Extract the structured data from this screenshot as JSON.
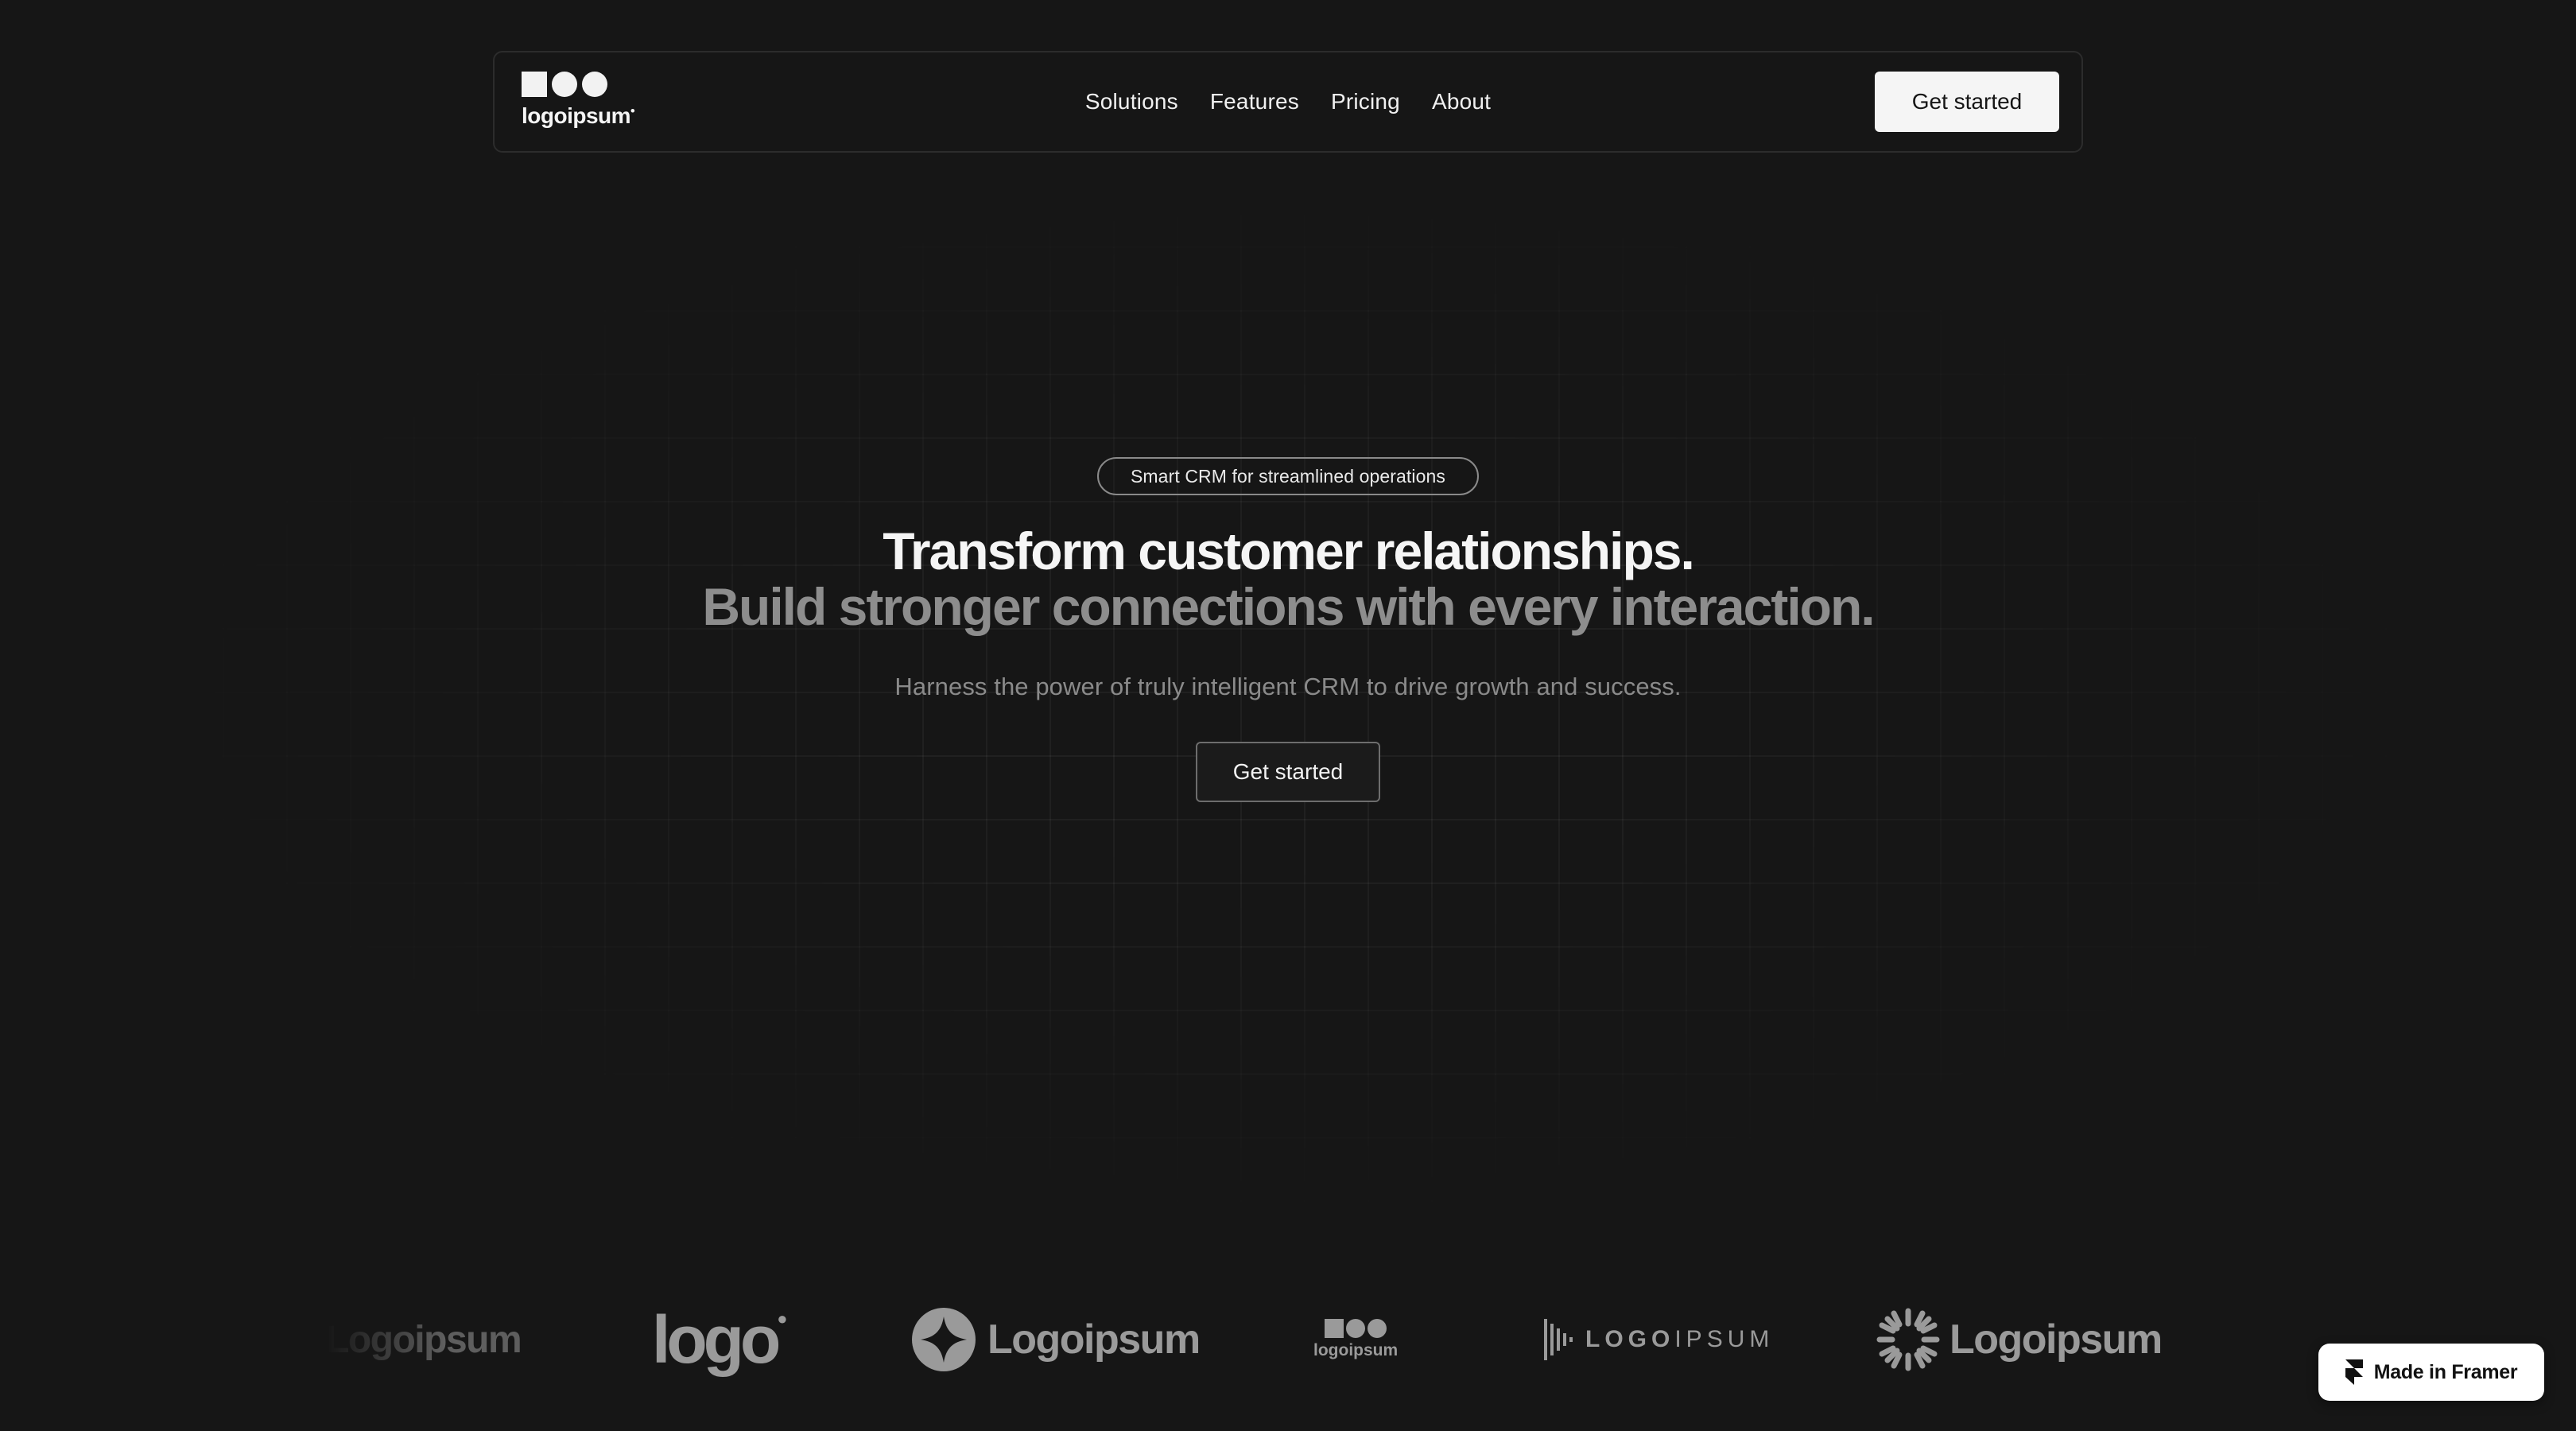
{
  "nav": {
    "brand": "logoipsum",
    "links": [
      "Solutions",
      "Features",
      "Pricing",
      "About"
    ],
    "cta": "Get started"
  },
  "hero": {
    "badge": "Smart CRM for streamlined operations",
    "headline_1": "Transform customer relationships.",
    "headline_2": "Build stronger connections with every interaction.",
    "subtext": "Harness the power of truly intelligent CRM to drive growth and success.",
    "cta": "Get started"
  },
  "logos": {
    "l1": "Logoipsum",
    "l2": "logo",
    "l3": "Logoipsum",
    "l4": "logoipsum",
    "l5_a": "LOGO",
    "l5_b": "IPSUM",
    "l6": "Logoipsum"
  },
  "framer_badge": "Made in Framer",
  "colors": {
    "background": "#161616",
    "text": "#f5f5f5",
    "muted": "#8d8d8d",
    "cta_bg": "#f5f5f5"
  }
}
